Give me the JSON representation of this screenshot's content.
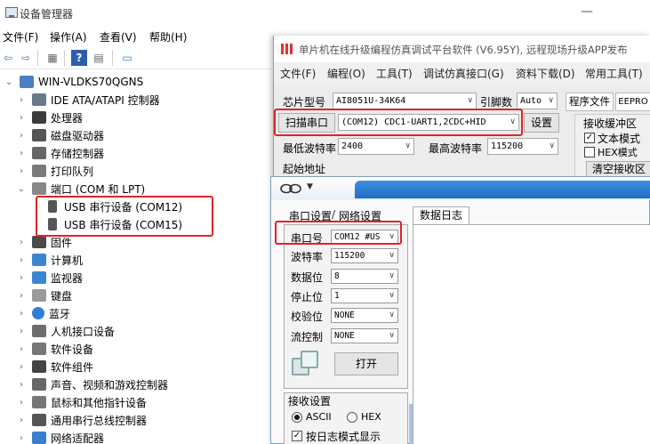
{
  "devmgr": {
    "title": "设备管理器",
    "menu": [
      "文件(F)",
      "操作(A)",
      "查看(V)",
      "帮助(H)"
    ],
    "min_glyph": "—",
    "computer": "WIN-VLDKS70QGNS",
    "tree": [
      {
        "label": "IDE ATA/ATAPI 控制器",
        "icon": "ide-controller-icon",
        "expanded": false
      },
      {
        "label": "处理器",
        "icon": "processor-icon",
        "expanded": false
      },
      {
        "label": "磁盘驱动器",
        "icon": "disk-drive-icon",
        "expanded": false
      },
      {
        "label": "存储控制器",
        "icon": "storage-controller-icon",
        "expanded": false
      },
      {
        "label": "打印队列",
        "icon": "printer-icon",
        "expanded": false
      },
      {
        "label": "端口 (COM 和 LPT)",
        "icon": "port-icon",
        "expanded": true
      },
      {
        "label": "USB 串行设备 (COM12)",
        "icon": "usb-serial-icon",
        "child": true
      },
      {
        "label": "USB 串行设备 (COM15)",
        "icon": "usb-serial-icon",
        "child": true
      },
      {
        "label": "固件",
        "icon": "firmware-icon",
        "expanded": false
      },
      {
        "label": "计算机",
        "icon": "computer-icon",
        "expanded": false
      },
      {
        "label": "监视器",
        "icon": "monitor-icon",
        "expanded": false
      },
      {
        "label": "键盘",
        "icon": "keyboard-icon",
        "expanded": false
      },
      {
        "label": "蓝牙",
        "icon": "bluetooth-icon",
        "expanded": false
      },
      {
        "label": "人机接口设备",
        "icon": "hid-icon",
        "expanded": false
      },
      {
        "label": "软件设备",
        "icon": "software-device-icon",
        "expanded": false
      },
      {
        "label": "软件组件",
        "icon": "software-component-icon",
        "expanded": false
      },
      {
        "label": "声音、视频和游戏控制器",
        "icon": "sound-icon",
        "expanded": false
      },
      {
        "label": "鼠标和其他指针设备",
        "icon": "mouse-icon",
        "expanded": false
      },
      {
        "label": "通用串行总线控制器",
        "icon": "usb-controller-icon",
        "expanded": false
      },
      {
        "label": "网络适配器",
        "icon": "network-adapter-icon",
        "expanded": false
      }
    ]
  },
  "stc": {
    "title": "单片机在线升级编程仿真调试平台软件 (V6.95Y), 远程现场升级APP发布",
    "menu": [
      "文件(F)",
      "编程(O)",
      "工具(T)",
      "调试仿真接口(G)",
      "资料下载(D)",
      "常用工具(T)"
    ],
    "chip_label": "芯片型号",
    "chip_value": "AI8051U-34K64",
    "pin_label": "引脚数",
    "pin_value": "Auto",
    "scan_button": "扫描串口",
    "port_value": "(COM12) CDC1-UART1,2CDC+HID",
    "settings_button": "设置",
    "min_baud_label": "最低波特率",
    "min_baud_value": "2400",
    "max_baud_label": "最高波特率",
    "max_baud_value": "115200",
    "start_addr_label": "起始地址",
    "tab_program_file": "程序文件",
    "tab_eeprom": "EEPRO",
    "recv_buffer_label": "接收缓冲区",
    "text_mode_label": "文本模式",
    "hex_mode_label": "HEX模式",
    "clear_recv_button": "清空接收区"
  },
  "dbg": {
    "tab_serial": "串口设置",
    "tab_network": "网络设置",
    "log_tab": "数据日志",
    "fields": [
      {
        "label": "串口号",
        "value": "COM12 #US"
      },
      {
        "label": "波特率",
        "value": "115200"
      },
      {
        "label": "数据位",
        "value": "8"
      },
      {
        "label": "停止位",
        "value": "1"
      },
      {
        "label": "校验位",
        "value": "NONE"
      },
      {
        "label": "流控制",
        "value": "NONE"
      }
    ],
    "open_button": "打开",
    "recv_settings_label": "接收设置",
    "ascii_label": "ASCII",
    "hex_label": "HEX",
    "log_mode_label": "按日志模式显示"
  },
  "colors": {
    "highlight": "#e0232a",
    "accent": "#2f7fd6"
  }
}
